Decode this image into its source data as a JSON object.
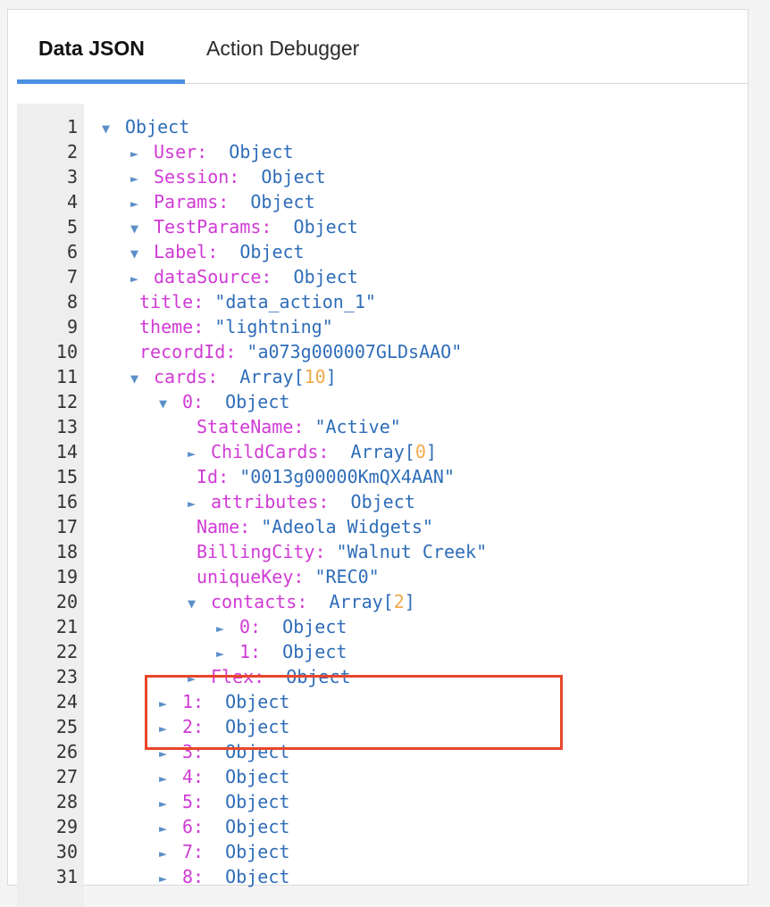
{
  "tabs": [
    {
      "label": "Data JSON",
      "active": true
    },
    {
      "label": "Action Debugger",
      "active": false
    }
  ],
  "tree_lines": [
    {
      "num": "1",
      "indent": 0,
      "arrow": "▼",
      "key": "",
      "sep": "",
      "value": "Object",
      "type": "obj"
    },
    {
      "num": "2",
      "indent": 1,
      "arrow": "►",
      "key": "User",
      "sep": ":  ",
      "value": "Object",
      "type": "obj"
    },
    {
      "num": "3",
      "indent": 1,
      "arrow": "►",
      "key": "Session",
      "sep": ":  ",
      "value": "Object",
      "type": "obj"
    },
    {
      "num": "4",
      "indent": 1,
      "arrow": "►",
      "key": "Params",
      "sep": ":  ",
      "value": "Object",
      "type": "obj"
    },
    {
      "num": "5",
      "indent": 1,
      "arrow": "▼",
      "key": "TestParams",
      "sep": ":  ",
      "value": "Object",
      "type": "obj"
    },
    {
      "num": "6",
      "indent": 1,
      "arrow": "▼",
      "key": "Label",
      "sep": ":  ",
      "value": "Object",
      "type": "obj"
    },
    {
      "num": "7",
      "indent": 1,
      "arrow": "►",
      "key": "dataSource",
      "sep": ":  ",
      "value": "Object",
      "type": "obj"
    },
    {
      "num": "8",
      "indent": 1,
      "arrow": "",
      "key": "title",
      "sep": ": ",
      "value": "\"data_action_1\"",
      "type": "str"
    },
    {
      "num": "9",
      "indent": 1,
      "arrow": "",
      "key": "theme",
      "sep": ": ",
      "value": "\"lightning\"",
      "type": "str"
    },
    {
      "num": "10",
      "indent": 1,
      "arrow": "",
      "key": "recordId",
      "sep": ": ",
      "value": "\"a073g000007GLDsAAO\"",
      "type": "str"
    },
    {
      "num": "11",
      "indent": 1,
      "arrow": "▼",
      "key": "cards",
      "sep": ":  ",
      "value": "Array",
      "type": "arr",
      "count": "10"
    },
    {
      "num": "12",
      "indent": 2,
      "arrow": "▼",
      "key": "0",
      "sep": ":  ",
      "value": "Object",
      "type": "obj"
    },
    {
      "num": "13",
      "indent": 3,
      "arrow": "",
      "key": "StateName",
      "sep": ": ",
      "value": "\"Active\"",
      "type": "str"
    },
    {
      "num": "14",
      "indent": 3,
      "arrow": "►",
      "key": "ChildCards",
      "sep": ":  ",
      "value": "Array",
      "type": "arr",
      "count": "0"
    },
    {
      "num": "15",
      "indent": 3,
      "arrow": "",
      "key": "Id",
      "sep": ": ",
      "value": "\"0013g00000KmQX4AAN\"",
      "type": "str"
    },
    {
      "num": "16",
      "indent": 3,
      "arrow": "►",
      "key": "attributes",
      "sep": ":  ",
      "value": "Object",
      "type": "obj"
    },
    {
      "num": "17",
      "indent": 3,
      "arrow": "",
      "key": "Name",
      "sep": ": ",
      "value": "\"Adeola Widgets\"",
      "type": "str"
    },
    {
      "num": "18",
      "indent": 3,
      "arrow": "",
      "key": "BillingCity",
      "sep": ": ",
      "value": "\"Walnut Creek\"",
      "type": "str"
    },
    {
      "num": "19",
      "indent": 3,
      "arrow": "",
      "key": "uniqueKey",
      "sep": ": ",
      "value": "\"REC0\"",
      "type": "str"
    },
    {
      "num": "20",
      "indent": 3,
      "arrow": "▼",
      "key": "contacts",
      "sep": ":  ",
      "value": "Array",
      "type": "arr",
      "count": "2"
    },
    {
      "num": "21",
      "indent": 4,
      "arrow": "►",
      "key": "0",
      "sep": ":  ",
      "value": "Object",
      "type": "obj"
    },
    {
      "num": "22",
      "indent": 4,
      "arrow": "►",
      "key": "1",
      "sep": ":  ",
      "value": "Object",
      "type": "obj"
    },
    {
      "num": "23",
      "indent": 3,
      "arrow": "►",
      "key": "Flex",
      "sep": ":  ",
      "value": "Object",
      "type": "obj"
    },
    {
      "num": "24",
      "indent": 2,
      "arrow": "►",
      "key": "1",
      "sep": ":  ",
      "value": "Object",
      "type": "obj"
    },
    {
      "num": "25",
      "indent": 2,
      "arrow": "►",
      "key": "2",
      "sep": ":  ",
      "value": "Object",
      "type": "obj"
    },
    {
      "num": "26",
      "indent": 2,
      "arrow": "►",
      "key": "3",
      "sep": ":  ",
      "value": "Object",
      "type": "obj"
    },
    {
      "num": "27",
      "indent": 2,
      "arrow": "►",
      "key": "4",
      "sep": ":  ",
      "value": "Object",
      "type": "obj"
    },
    {
      "num": "28",
      "indent": 2,
      "arrow": "►",
      "key": "5",
      "sep": ":  ",
      "value": "Object",
      "type": "obj"
    },
    {
      "num": "29",
      "indent": 2,
      "arrow": "►",
      "key": "6",
      "sep": ":  ",
      "value": "Object",
      "type": "obj"
    },
    {
      "num": "30",
      "indent": 2,
      "arrow": "►",
      "key": "7",
      "sep": ":  ",
      "value": "Object",
      "type": "obj"
    },
    {
      "num": "31",
      "indent": 2,
      "arrow": "►",
      "key": "8",
      "sep": ":  ",
      "value": "Object",
      "type": "obj"
    }
  ],
  "colors": {
    "tab_underline": "#4a90e2",
    "key": "#d03bd4",
    "value": "#2f6db8",
    "count": "#f0a94a",
    "highlight_box": "#e8462a"
  }
}
